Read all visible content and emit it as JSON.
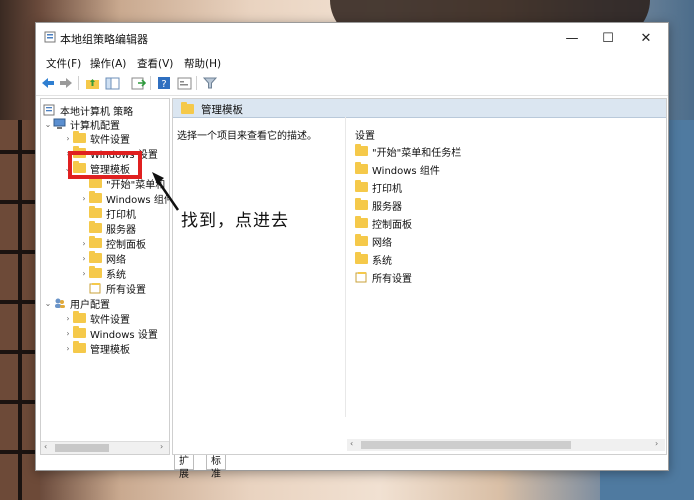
{
  "window": {
    "title": "本地组策略编辑器",
    "controls": {
      "minimize": "—",
      "maximize": "☐",
      "close": "✕"
    }
  },
  "menubar": [
    "文件(F)",
    "操作(A)",
    "查看(V)",
    "帮助(H)"
  ],
  "toolbar": {
    "icons": [
      "back-arrow-icon",
      "forward-arrow-icon",
      "up-folder-icon",
      "show-hide-tree-icon",
      "export-list-icon",
      "help-icon",
      "properties-icon",
      "filter-icon"
    ]
  },
  "tree": {
    "root": "本地计算机 策略",
    "computer_config": "计算机配置",
    "software_settings": "软件设置",
    "windows_settings": "Windows 设置",
    "admin_templates": "管理模板",
    "start_menu": "\"开始\"菜单和",
    "windows_components": "Windows 组件",
    "printers": "打印机",
    "servers": "服务器",
    "control_panel": "控制面板",
    "network": "网络",
    "system": "系统",
    "all_settings": "所有设置",
    "user_config": "用户配置",
    "user_software_settings": "软件设置",
    "user_windows_settings": "Windows 设置",
    "user_admin_templates": "管理模板"
  },
  "pane": {
    "header": "管理模板",
    "description": "选择一个项目来查看它的描述。",
    "list_header": "设置",
    "items": [
      "\"开始\"菜单和任务栏",
      "Windows 组件",
      "打印机",
      "服务器",
      "控制面板",
      "网络",
      "系统",
      "所有设置"
    ]
  },
  "tabs": {
    "extended": "扩展",
    "standard": "标准"
  },
  "annotation": {
    "text": "找到，点进去"
  },
  "colors": {
    "highlight": "#e02020",
    "folder": "#f5c94a",
    "header_bg": "#dbe6f1"
  }
}
